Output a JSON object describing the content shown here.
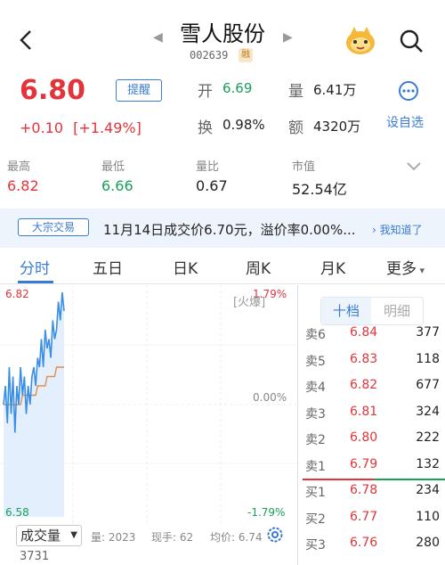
{
  "header": {
    "title": "雪人股份",
    "code": "002639",
    "margin_badge": "融"
  },
  "quote": {
    "price": "6.80",
    "change": "+0.10",
    "change_pct": "[+1.49%]",
    "remind_label": "提醒",
    "open_label": "开",
    "open_value": "6.69",
    "volume_label": "量",
    "volume_value": "6.41万",
    "turnover_label": "换",
    "turnover_value": "0.98%",
    "amount_label": "额",
    "amount_value": "4320万",
    "custom_label": "设自选"
  },
  "stats": [
    {
      "label": "最高",
      "value": "6.82",
      "color": "#e2343a"
    },
    {
      "label": "最低",
      "value": "6.66",
      "color": "#1aa05a"
    },
    {
      "label": "量比",
      "value": "0.67",
      "color": "#222222"
    },
    {
      "label": "市值",
      "value": "52.54亿",
      "color": "#222222"
    }
  ],
  "notice": {
    "tag": "大宗交易",
    "text": "11月14日成交价6.70元，溢价率0.00%...",
    "action": "我知道了"
  },
  "tabs": [
    "分时",
    "五日",
    "日K",
    "周K",
    "月K",
    "更多"
  ],
  "chart": {
    "y_top": "6.82",
    "y_bottom": "6.58",
    "pct_top": "1.79%",
    "pct_mid": "0.00%",
    "pct_bottom": "-1.79%",
    "hot_label": "[火爆]",
    "colors": {
      "price_line": "#3a8ee6",
      "avg_line": "#e0904a",
      "fill": "#e3effc"
    }
  },
  "chart_data": {
    "type": "line",
    "y_range": [
      6.58,
      6.82
    ],
    "series": [
      {
        "values": [
          6.7,
          6.72,
          6.68,
          6.74,
          6.69,
          6.73,
          6.67,
          6.72,
          6.7,
          6.74,
          6.71,
          6.73,
          6.69,
          6.72,
          6.7,
          6.73,
          6.74,
          6.72,
          6.75,
          6.74,
          6.77,
          6.74,
          6.78,
          6.76,
          6.77,
          6.75,
          6.79,
          6.77,
          6.78,
          6.81,
          6.79,
          6.82,
          6.8
        ]
      },
      {
        "values": [
          6.7,
          6.7,
          6.7,
          6.7,
          6.7,
          6.7,
          6.7,
          6.7,
          6.7,
          6.7,
          6.71,
          6.71,
          6.71,
          6.71,
          6.71,
          6.71,
          6.71,
          6.71,
          6.72,
          6.72,
          6.72,
          6.72,
          6.72,
          6.73,
          6.73,
          6.73,
          6.73,
          6.73,
          6.74,
          6.74,
          6.74,
          6.74,
          6.74
        ]
      }
    ]
  },
  "order_book": {
    "tab_active": "十档",
    "tab_inactive": "明细",
    "rows": [
      {
        "label": "卖6",
        "price": "6.84",
        "qty": "377",
        "side": "sell"
      },
      {
        "label": "卖5",
        "price": "6.83",
        "qty": "118",
        "side": "sell"
      },
      {
        "label": "卖4",
        "price": "6.82",
        "qty": "677",
        "side": "sell"
      },
      {
        "label": "卖3",
        "price": "6.81",
        "qty": "324",
        "side": "sell"
      },
      {
        "label": "卖2",
        "price": "6.80",
        "qty": "222",
        "side": "sell"
      },
      {
        "label": "卖1",
        "price": "6.79",
        "qty": "132",
        "side": "sell"
      },
      {
        "label": "买1",
        "price": "6.78",
        "qty": "234",
        "side": "buy"
      },
      {
        "label": "买2",
        "price": "6.77",
        "qty": "110",
        "side": "buy"
      },
      {
        "label": "买3",
        "price": "6.76",
        "qty": "280",
        "side": "buy"
      }
    ]
  },
  "volume": {
    "selector": "成交量",
    "total": "量: 2023",
    "current": "现手: 62",
    "avg": "均价: 6.74",
    "value": "3731"
  },
  "icons": [
    "back-arrow-icon",
    "prev-stock-icon",
    "next-stock-icon",
    "mascot-icon",
    "search-icon",
    "more-dots-icon",
    "chevron-down-icon",
    "chevron-right-icon",
    "settings-gear-icon"
  ]
}
